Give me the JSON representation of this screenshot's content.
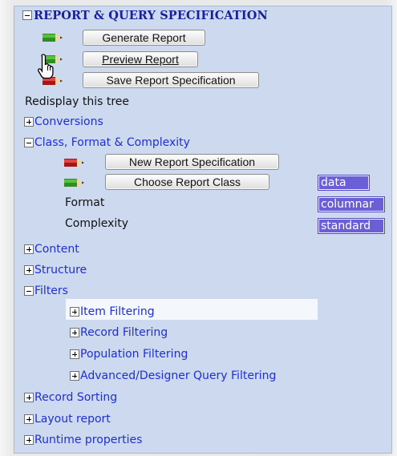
{
  "tree": {
    "root": {
      "label": "REPORT & QUERY SPECIFICATION",
      "expanded": true
    },
    "root_buttons": [
      {
        "label": "Generate Report",
        "pencil": "green"
      },
      {
        "label": "Preview Report",
        "pencil": "green"
      },
      {
        "label": "Save Report Specification",
        "pencil": "red"
      }
    ],
    "redisplay_text": "Redisplay this tree",
    "conversions": {
      "label": "Conversions",
      "expanded": false
    },
    "class_format": {
      "label": "Class, Format & Complexity",
      "expanded": true,
      "buttons": [
        {
          "label": "New Report Specification",
          "pencil": "red"
        },
        {
          "label": "Choose Report Class",
          "pencil": "green"
        }
      ],
      "class_value": "data",
      "format_label": "Format",
      "format_value": "columnar",
      "complexity_label": "Complexity",
      "complexity_value": "standard"
    },
    "content": {
      "label": "Content",
      "expanded": false
    },
    "structure": {
      "label": "Structure",
      "expanded": false
    },
    "filters": {
      "label": "Filters",
      "expanded": true,
      "children": [
        {
          "label": "Item Filtering",
          "expanded": false
        },
        {
          "label": "Record Filtering",
          "expanded": false
        },
        {
          "label": "Population Filtering",
          "expanded": false
        },
        {
          "label": "Advanced/Designer Query Filtering",
          "expanded": false
        }
      ]
    },
    "record_sorting": {
      "label": "Record Sorting",
      "expanded": false
    },
    "layout_report": {
      "label": "Layout report",
      "expanded": false
    },
    "runtime_properties": {
      "label": "Runtime properties",
      "expanded": false
    }
  },
  "colors": {
    "panel_bg": "#ccd9ef",
    "link": "#1f2fd6",
    "badge_bg": "#6b5fd8",
    "pencil_green": "#39a32a",
    "pencil_red": "#c8201f"
  },
  "icons": {
    "toggle_expanded": "minus-box-icon",
    "toggle_collapsed": "plus-box-icon",
    "pencil": "pencil-icon",
    "cursor": "hand-pointer-icon"
  }
}
